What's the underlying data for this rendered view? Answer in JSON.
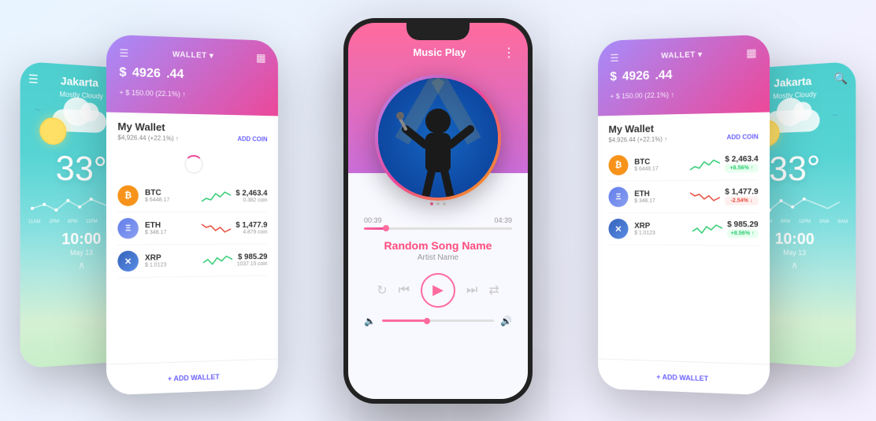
{
  "app": {
    "title": "Music Play"
  },
  "weather": {
    "city": "Jakarta",
    "condition": "Mostly Cloudy",
    "temperature": "33°",
    "time": "10:00",
    "date": "May 13",
    "graph_labels": [
      "11AM",
      "2PM",
      "8PM",
      "11PM",
      "3AM",
      "8AM"
    ]
  },
  "wallet": {
    "title": "WALLET ▾",
    "amount": "4926",
    "amount_cents": ".44",
    "currency_symbol": "$",
    "change": "+ $ 150.00 (22.1%) ↑",
    "section_title": "My Wallet",
    "section_sub": "$4,926.44 (+22.1%) ↑",
    "add_coin_label": "ADD COIN",
    "add_wallet_label": "+ ADD WALLET",
    "coins": [
      {
        "symbol": "BTC",
        "usd": "$ 6448.17",
        "price": "$ 2,463.4",
        "amount": "0.382 coin",
        "change": "+8.56%",
        "positive": true
      },
      {
        "symbol": "ETH",
        "usd": "$ 348.17",
        "price": "$ 1,477.9",
        "amount": "4.879 coin",
        "change": "-2.54%",
        "positive": false
      },
      {
        "symbol": "XRP",
        "usd": "$ 1.0123",
        "price": "$ 985.29",
        "amount": "1037.15 coin",
        "change": "+8.56%",
        "positive": true
      }
    ]
  },
  "music": {
    "title": "Music Play",
    "song_name": "Random Song Name",
    "artist_name": "Artist Name",
    "time_current": "00:39",
    "time_total": "04:39",
    "progress_percent": 15,
    "volume_percent": 40
  },
  "icons": {
    "hamburger": "☰",
    "search": "🔍",
    "menu_dots": "⋮",
    "repeat": "↻",
    "prev": "⏮",
    "play": "▶",
    "next": "⏭",
    "shuffle": "⇄",
    "vol_low": "🔈",
    "vol_high": "🔊",
    "chevron_up": "∧",
    "add_wallet": "🪙",
    "qr": "▦"
  }
}
